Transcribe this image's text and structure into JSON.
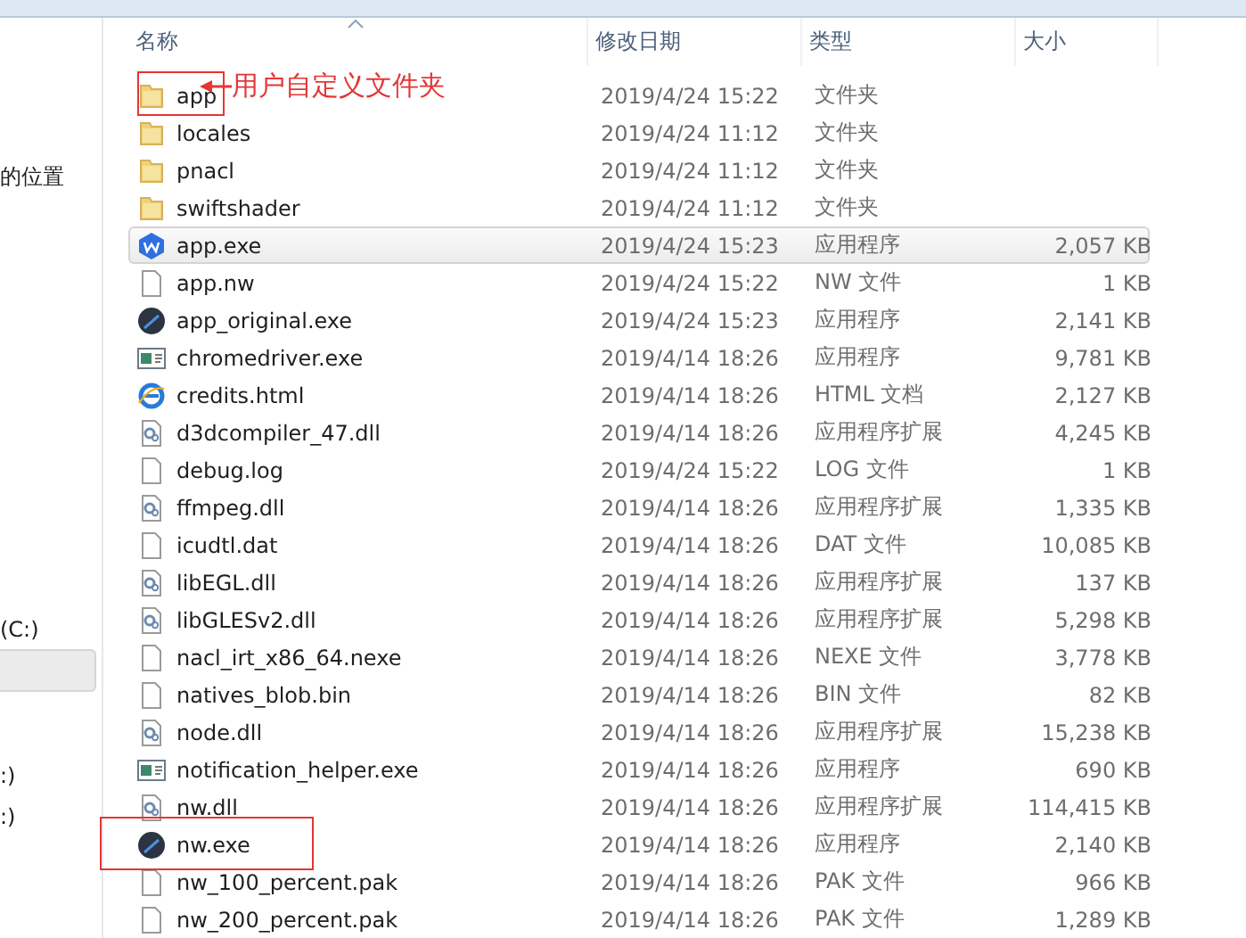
{
  "sidebar": {
    "items": [
      {
        "label": "的位置",
        "selected": false
      },
      {
        "label": "(C:)",
        "selected": false
      },
      {
        "selected": true
      },
      {
        "label": ":)",
        "selected": false
      },
      {
        "label": ":)",
        "selected": false
      }
    ]
  },
  "columns": [
    "名称",
    "修改日期",
    "类型",
    "大小"
  ],
  "rows": [
    {
      "kind": "folder",
      "name": "app",
      "date": "2019/4/24 15:22",
      "type": "文件夹",
      "selected": false,
      "marked": true,
      "callout": "用户自定义文件夹"
    },
    {
      "kind": "folder",
      "name": "locales",
      "date": "2019/4/24 11:12",
      "type": "文件夹",
      "selected": false
    },
    {
      "kind": "folder",
      "name": "pnacl",
      "date": "2019/4/24 11:12",
      "type": "文件夹",
      "selected": false
    },
    {
      "kind": "folder",
      "name": "swiftshader",
      "date": "2019/4/24 11:12",
      "type": "文件夹",
      "selected": false
    },
    {
      "kind": "hexagon",
      "name": "app.exe",
      "date": "2019/4/24 15:23",
      "type": "应用程序",
      "size": "2,057 KB",
      "selected": true
    },
    {
      "kind": "file",
      "name": "app.nw",
      "date": "2019/4/24 15:22",
      "type": "NW 文件",
      "size": "1 KB",
      "selected": false
    },
    {
      "kind": "round",
      "name": "app_original.exe",
      "date": "2019/4/24 15:23",
      "type": "应用程序",
      "size": "2,141 KB",
      "selected": false
    },
    {
      "kind": "window",
      "name": "chromedriver.exe",
      "date": "2019/4/14 18:26",
      "type": "应用程序",
      "size": "9,781 KB",
      "selected": false
    },
    {
      "kind": "web",
      "name": "credits.html",
      "date": "2019/4/14 18:26",
      "type": "HTML 文档",
      "size": "2,127 KB",
      "selected": false
    },
    {
      "kind": "gear",
      "name": "d3dcompiler_47.dll",
      "date": "2019/4/14 18:26",
      "type": "应用程序扩展",
      "size": "4,245 KB",
      "selected": false
    },
    {
      "kind": "file",
      "name": "debug.log",
      "date": "2019/4/24 15:22",
      "type": "LOG 文件",
      "size": "1 KB",
      "selected": false
    },
    {
      "kind": "gear",
      "name": "ffmpeg.dll",
      "date": "2019/4/14 18:26",
      "type": "应用程序扩展",
      "size": "1,335 KB",
      "selected": false
    },
    {
      "kind": "file",
      "name": "icudtl.dat",
      "date": "2019/4/14 18:26",
      "type": "DAT 文件",
      "size": "10,085 KB",
      "selected": false
    },
    {
      "kind": "gear",
      "name": "libEGL.dll",
      "date": "2019/4/14 18:26",
      "type": "应用程序扩展",
      "size": "137 KB",
      "selected": false
    },
    {
      "kind": "gear",
      "name": "libGLESv2.dll",
      "date": "2019/4/14 18:26",
      "type": "应用程序扩展",
      "size": "5,298 KB",
      "selected": false
    },
    {
      "kind": "file",
      "name": "nacl_irt_x86_64.nexe",
      "date": "2019/4/14 18:26",
      "type": "NEXE 文件",
      "size": "3,778 KB",
      "selected": false
    },
    {
      "kind": "file",
      "name": "natives_blob.bin",
      "date": "2019/4/14 18:26",
      "type": "BIN 文件",
      "size": "82 KB",
      "selected": false
    },
    {
      "kind": "gear",
      "name": "node.dll",
      "date": "2019/4/14 18:26",
      "type": "应用程序扩展",
      "size": "15,238 KB",
      "selected": false
    },
    {
      "kind": "window",
      "name": "notification_helper.exe",
      "date": "2019/4/14 18:26",
      "type": "应用程序",
      "size": "690 KB",
      "selected": false
    },
    {
      "kind": "gear",
      "name": "nw.dll",
      "date": "2019/4/14 18:26",
      "type": "应用程序扩展",
      "size": "114,415 KB",
      "selected": false
    },
    {
      "kind": "round",
      "name": "nw.exe",
      "date": "2019/4/14 18:26",
      "type": "应用程序",
      "size": "2,140 KB",
      "selected": false,
      "marked": true
    },
    {
      "kind": "file",
      "name": "nw_100_percent.pak",
      "date": "2019/4/14 18:26",
      "type": "PAK 文件",
      "size": "966 KB",
      "selected": false
    },
    {
      "kind": "file",
      "name": "nw_200_percent.pak",
      "date": "2019/4/14 18:26",
      "type": "PAK 文件",
      "size": "1,289 KB",
      "selected": false
    }
  ]
}
